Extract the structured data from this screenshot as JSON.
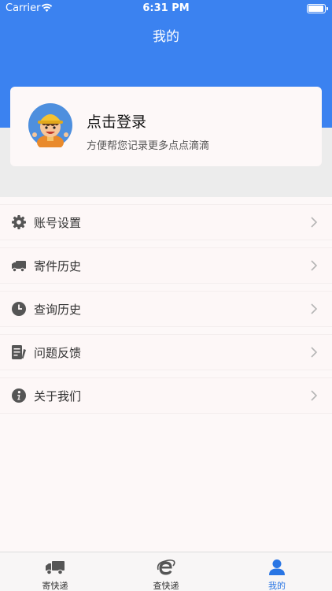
{
  "status_bar": {
    "carrier": "Carrier",
    "time": "6:31 PM"
  },
  "header": {
    "title": "我的"
  },
  "profile": {
    "title": "点击登录",
    "subtitle": "方便帮您记录更多点点滴滴"
  },
  "menu": {
    "items": [
      {
        "label": "账号设置",
        "icon": "gear-icon"
      },
      {
        "label": "寄件历史",
        "icon": "truck-icon"
      },
      {
        "label": "查询历史",
        "icon": "clock-icon"
      },
      {
        "label": "问题反馈",
        "icon": "document-icon"
      },
      {
        "label": "关于我们",
        "icon": "info-icon"
      }
    ]
  },
  "tabs": [
    {
      "label": "寄快递",
      "icon": "truck-icon"
    },
    {
      "label": "查快递",
      "icon": "browser-e-icon"
    },
    {
      "label": "我的",
      "icon": "person-icon",
      "active": true
    }
  ],
  "colors": {
    "accent": "#3b82f0",
    "tab_active": "#2a76e4",
    "icon_gray": "#555555"
  }
}
